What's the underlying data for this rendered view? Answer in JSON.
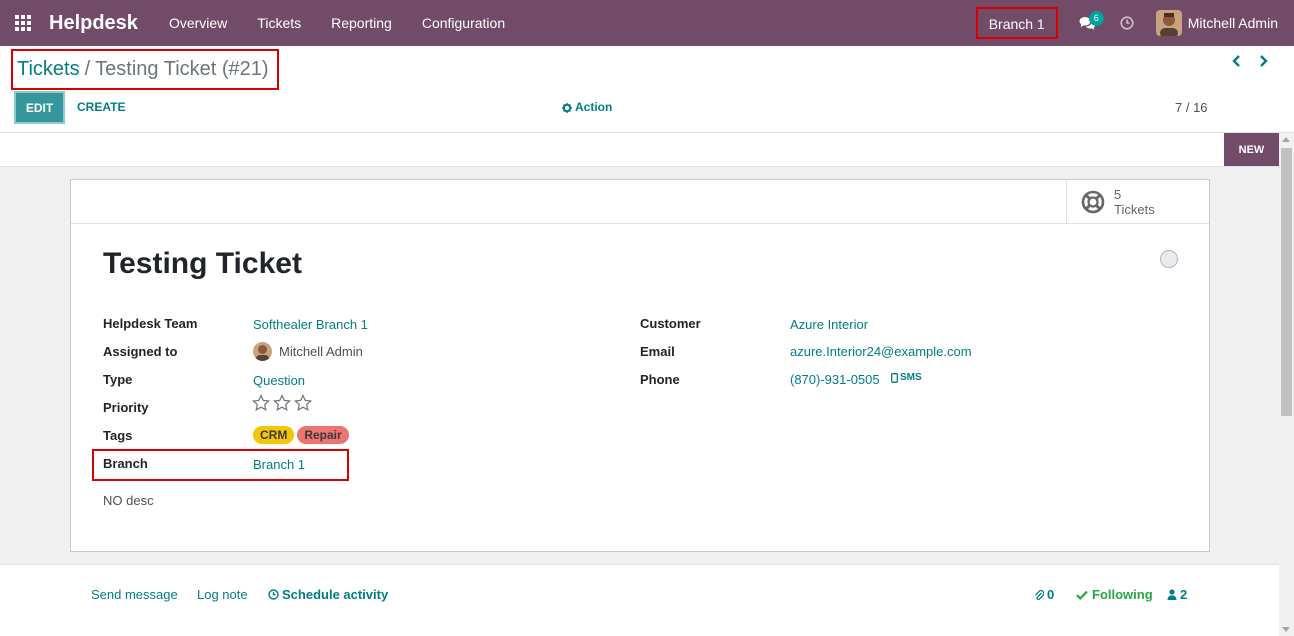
{
  "navbar": {
    "brand": "Helpdesk",
    "menu": [
      "Overview",
      "Tickets",
      "Reporting",
      "Configuration"
    ],
    "branch": "Branch 1",
    "chat_count": "6",
    "user_name": "Mitchell Admin"
  },
  "control_panel": {
    "breadcrumb_parent": "Tickets",
    "breadcrumb_separator": "/",
    "breadcrumb_current": "Testing Ticket (#21)",
    "edit_label": "EDIT",
    "create_label": "CREATE",
    "action_label": "Action",
    "pager": "7 / 16"
  },
  "statusbar": {
    "stage": "NEW"
  },
  "smart_button": {
    "count": "5",
    "label": "Tickets"
  },
  "ticket": {
    "title": "Testing Ticket",
    "fields_left": [
      {
        "label": "Helpdesk Team",
        "value": "Softhealer Branch 1"
      },
      {
        "label": "Assigned to",
        "value": "Mitchell Admin"
      },
      {
        "label": "Type",
        "value": "Question"
      },
      {
        "label": "Priority",
        "value": ""
      },
      {
        "label": "Tags",
        "value": ""
      },
      {
        "label": "Branch",
        "value": "Branch 1"
      }
    ],
    "fields_right": [
      {
        "label": "Customer",
        "value": "Azure Interior"
      },
      {
        "label": "Email",
        "value": "azure.Interior24@example.com"
      },
      {
        "label": "Phone",
        "value": "(870)-931-0505"
      }
    ],
    "sms_label": "SMS",
    "priority_stars": 0,
    "priority_max": 3,
    "tags": [
      "CRM",
      "Repair"
    ],
    "description": "NO desc"
  },
  "chatter": {
    "send_message": "Send message",
    "log_note": "Log note",
    "schedule_activity": "Schedule activity",
    "attachments": "0",
    "following": "Following",
    "followers": "2"
  },
  "colors": {
    "brand": "#714B67",
    "link": "#017e84",
    "highlight": "#d80000",
    "tag_crm": "#f4c609",
    "tag_repair": "#ec7573"
  }
}
